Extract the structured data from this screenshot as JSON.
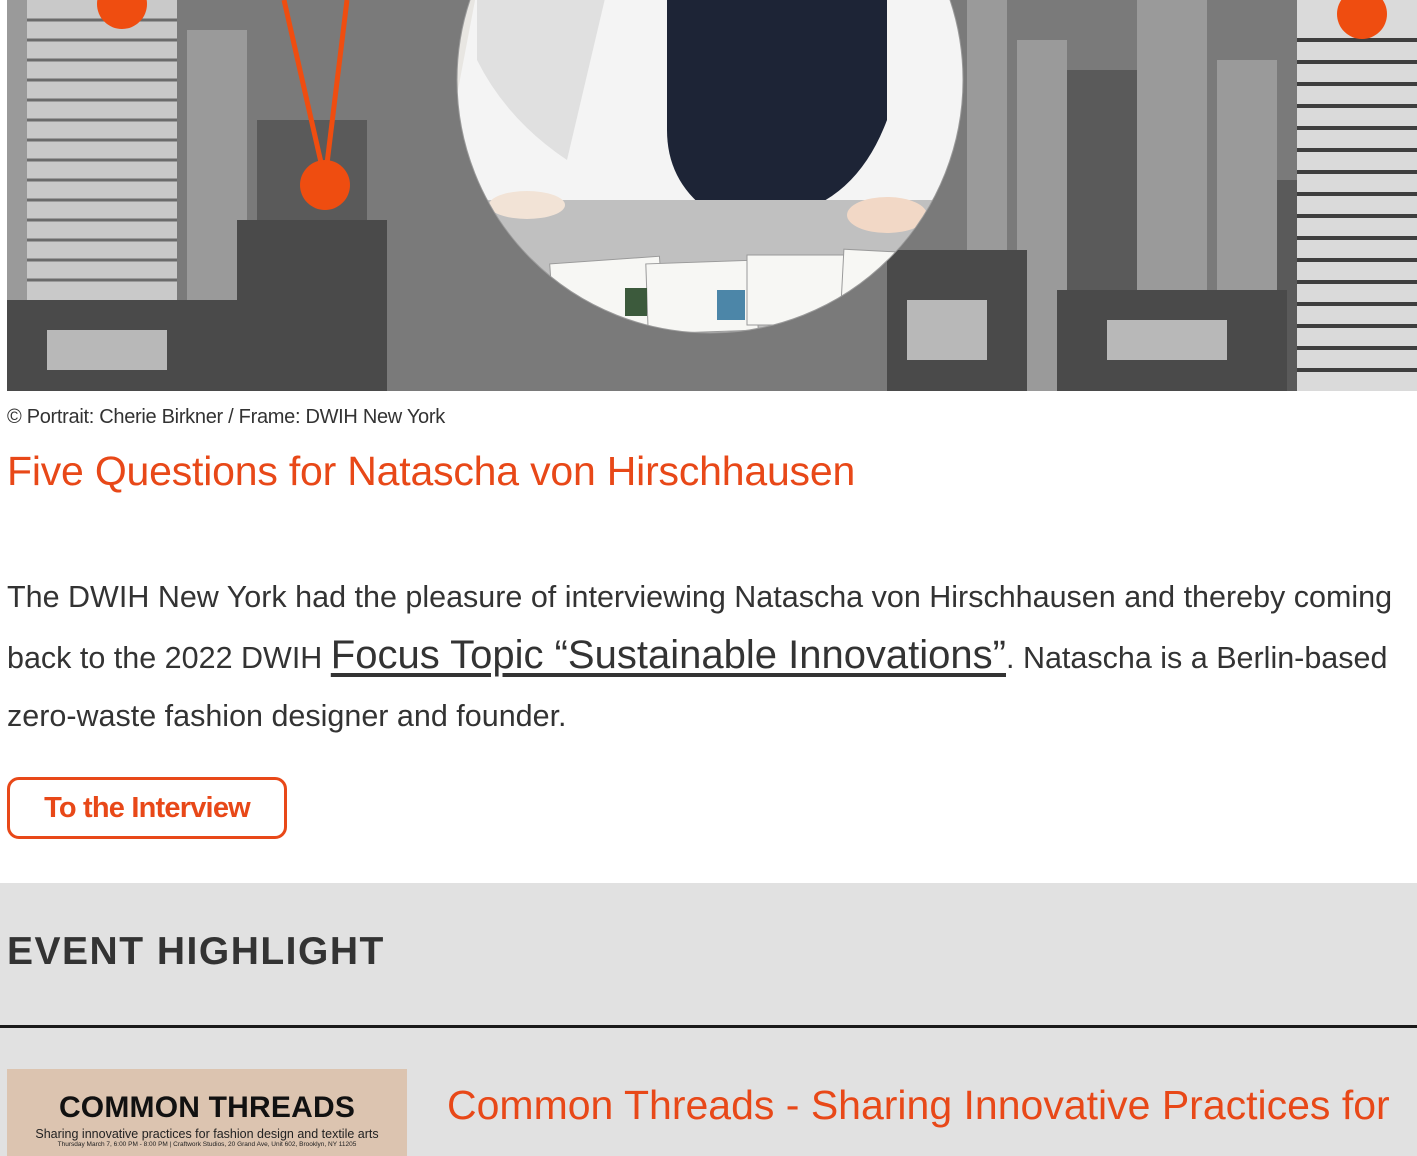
{
  "hero": {
    "image_label": "Portrait of Natascha von Hirschhausen in a circular frame over a New York skyline",
    "accent_color": "#e84818"
  },
  "caption": "© Portrait: Cherie Birkner / Frame: DWIH New York",
  "article": {
    "title": "Five Questions for Natascha von Hirschhausen",
    "body_before": "The DWIH New York had the pleasure of interviewing Natascha von Hirschhausen and thereby coming back to the 2022 DWIH ",
    "body_link": "Focus Topic “Sustainable Innovations”",
    "body_after": ". Natascha is a Berlin-based zero-waste fashion designer and founder.",
    "cta_label": "To the Interview"
  },
  "event_highlight": {
    "heading": "EVENT HIGHLIGHT",
    "thumbnail": {
      "title": "COMMON THREADS",
      "subtitle": "Sharing innovative practices for fashion design and textile arts",
      "date_line": "Thursday March 7, 6:00 PM - 8:00 PM | Craftwork Studios, 20 Grand Ave, Unit 602, Brooklyn, NY 11205"
    },
    "title": "Common Threads - Sharing Innovative Practices for"
  },
  "colors": {
    "accent": "#e84818",
    "band": "#e1e1e1",
    "text": "#333333"
  }
}
